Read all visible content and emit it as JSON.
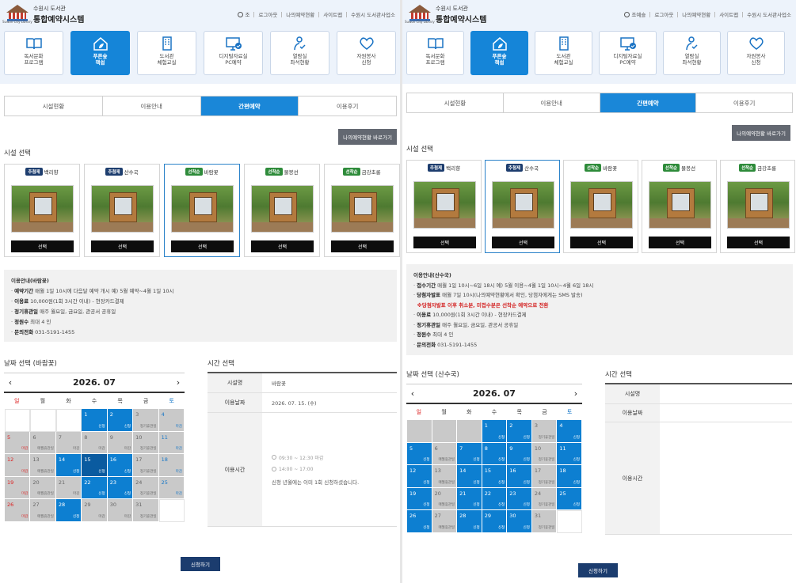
{
  "left": {
    "header": {
      "brand_sup": "수원시 도서관",
      "brand_title": "통합예약시스템",
      "logo_sub": "Suwon City Library",
      "user_label": "조",
      "top_links": [
        "로그아웃",
        "나의예약현황",
        "사이트맵",
        "수원시 도서관사업소"
      ]
    },
    "nav": [
      {
        "label": "독서문화\n프로그램",
        "icon": "book-icon"
      },
      {
        "label": "푸른숲\n책쉼",
        "icon": "house-leaf-icon"
      },
      {
        "label": "도서관\n체험교실",
        "icon": "building-icon"
      },
      {
        "label": "디지털자료실\nPC예약",
        "icon": "monitor-check-icon"
      },
      {
        "label": "열람실\n좌석현황",
        "icon": "person-check-icon"
      },
      {
        "label": "자원봉사\n신청",
        "icon": "heart-hand-icon"
      }
    ],
    "tabs": [
      "시설현황",
      "이용안내",
      "간편예약",
      "이용후기"
    ],
    "my_reservation_button": "나의예약현황 바로가기",
    "facility_title": "시설 선택",
    "facilities": [
      {
        "badge": "추첨제",
        "name": "백리향",
        "button": "선택"
      },
      {
        "badge": "추첨제",
        "name": "산수국",
        "button": "선택"
      },
      {
        "badge": "선착순",
        "name": "바람꽃",
        "button": "선택"
      },
      {
        "badge": "선착순",
        "name": "물봉선",
        "button": "선택"
      },
      {
        "badge": "선착순",
        "name": "금강초롱",
        "button": "선택"
      }
    ],
    "info": {
      "title": "이용안내(바람꽃)",
      "lines": [
        {
          "label": "예약기간",
          "text": "매월 1일 10시에 다음달 예약 개시 예) 5월 예약~4월 1일 10시"
        },
        {
          "label": "이용료",
          "text": "10,000원(1회 3시간 이내) - 현장카드결제"
        },
        {
          "label": "정기휴관일",
          "text": "매주 월요일, 금요일, 관공서 공휴일"
        },
        {
          "label": "정원수",
          "text": "최대 4 인"
        },
        {
          "label": "문의전화",
          "text": "031-5191-1455"
        }
      ]
    },
    "calendar": {
      "title": "날짜 선택 (바람꽃)",
      "prev": "‹",
      "next": "›",
      "month": "2026. 07",
      "dow": [
        "일",
        "월",
        "화",
        "수",
        "목",
        "금",
        "토"
      ]
    },
    "time": {
      "title": "시간 선택",
      "facility_label": "시설명",
      "facility_value": "바람꽃",
      "date_label": "이용날짜",
      "date_value": "2026. 07. 15. (수)",
      "time_label": "이용시간",
      "slots": [
        "09:30 ~ 12:30 마감",
        "14:00 ~ 17:00"
      ],
      "note": "신청 년월에는 이미 1회 신청하셨습니다."
    },
    "apply_button": "신청하기"
  },
  "right": {
    "header": {
      "brand_sup": "수원시 도서관",
      "brand_title": "통합예약시스템",
      "logo_sub": "Suwon City Library",
      "user_label": "조예슬",
      "top_links": [
        "로그아웃",
        "나의예약현황",
        "사이트맵",
        "수원시 도서관사업소"
      ]
    },
    "tabs": [
      "시설현황",
      "이용안내",
      "간편예약",
      "이용후기"
    ],
    "my_reservation_button": "나의예약현황 바로가기",
    "facility_title": "시설 선택",
    "facilities": [
      {
        "badge": "추첨제",
        "name": "백리향",
        "button": "선택"
      },
      {
        "badge": "추첨제",
        "name": "산수국",
        "button": "선택"
      },
      {
        "badge": "선착순",
        "name": "바람꽃",
        "button": "선택"
      },
      {
        "badge": "선착순",
        "name": "물봉선",
        "button": "선택"
      },
      {
        "badge": "선착순",
        "name": "금강초롱",
        "button": "선택"
      }
    ],
    "info": {
      "title": "이용안내(산수국)",
      "lines": [
        {
          "label": "접수기간",
          "text": "매월 1일 10시~6일 18시 예) 5월 이용~4월 1일 10시~4월 6일 18시"
        },
        {
          "label": "당첨자발표",
          "text": "매월 7일 10시(나의예약현황에서 확인, 당첨자에게는 SMS 발송)"
        },
        {
          "warn": "※당첨자발표 이후 취소분, 미접수분은 선착순 예약으로 전환"
        },
        {
          "label": "이용료",
          "text": "10,000원(1회 3시간 이내) - 현장카드결제"
        },
        {
          "label": "정기휴관일",
          "text": "매주 월요일, 금요일, 관공서 공휴일"
        },
        {
          "label": "정원수",
          "text": "최대 4 인"
        },
        {
          "label": "문의전화",
          "text": "031-5191-1455"
        }
      ]
    },
    "calendar": {
      "title": "날짜 선택 (산수국)",
      "prev": "‹",
      "next": "›",
      "month": "2026. 07",
      "dow": [
        "일",
        "월",
        "화",
        "수",
        "목",
        "금",
        "토"
      ]
    },
    "time": {
      "title": "시간 선택",
      "facility_label": "시설명",
      "date_label": "이용날짜",
      "time_label": "이용시간"
    },
    "apply_button": "신청하기"
  },
  "calendars": {
    "left_days": [
      {
        "d": "",
        "s": "",
        "t": "blank"
      },
      {
        "d": "",
        "s": "",
        "t": "blank"
      },
      {
        "d": "",
        "s": "",
        "t": "blank"
      },
      {
        "d": "1",
        "s": "신청",
        "t": "blue"
      },
      {
        "d": "2",
        "s": "신청",
        "t": "blue"
      },
      {
        "d": "3",
        "s": "정기휴관일",
        "t": "gray"
      },
      {
        "d": "4",
        "s": "마감",
        "t": "gray"
      },
      {
        "d": "5",
        "s": "마감",
        "t": "gray"
      },
      {
        "d": "6",
        "s": "매월휴관일",
        "t": "gray"
      },
      {
        "d": "7",
        "s": "마감",
        "t": "gray"
      },
      {
        "d": "8",
        "s": "마감",
        "t": "gray"
      },
      {
        "d": "9",
        "s": "마감",
        "t": "gray"
      },
      {
        "d": "10",
        "s": "정기휴관일",
        "t": "gray"
      },
      {
        "d": "11",
        "s": "마감",
        "t": "gray"
      },
      {
        "d": "12",
        "s": "마감",
        "t": "gray"
      },
      {
        "d": "13",
        "s": "매월휴관일",
        "t": "gray"
      },
      {
        "d": "14",
        "s": "신청",
        "t": "blue"
      },
      {
        "d": "15",
        "s": "신청",
        "t": "dark"
      },
      {
        "d": "16",
        "s": "신청",
        "t": "blue"
      },
      {
        "d": "17",
        "s": "정기휴관일",
        "t": "gray"
      },
      {
        "d": "18",
        "s": "마감",
        "t": "gray"
      },
      {
        "d": "19",
        "s": "마감",
        "t": "gray"
      },
      {
        "d": "20",
        "s": "매월휴관일",
        "t": "gray"
      },
      {
        "d": "21",
        "s": "마감",
        "t": "gray"
      },
      {
        "d": "22",
        "s": "신청",
        "t": "blue"
      },
      {
        "d": "23",
        "s": "신청",
        "t": "blue"
      },
      {
        "d": "24",
        "s": "정기휴관일",
        "t": "gray"
      },
      {
        "d": "25",
        "s": "마감",
        "t": "gray"
      },
      {
        "d": "26",
        "s": "마감",
        "t": "gray"
      },
      {
        "d": "27",
        "s": "매월휴관일",
        "t": "gray"
      },
      {
        "d": "28",
        "s": "신청",
        "t": "blue"
      },
      {
        "d": "29",
        "s": "마감",
        "t": "gray"
      },
      {
        "d": "30",
        "s": "마감",
        "t": "gray"
      },
      {
        "d": "31",
        "s": "정기휴관일",
        "t": "gray"
      },
      {
        "d": "",
        "s": "",
        "t": "blank"
      }
    ],
    "right_days": [
      {
        "d": "",
        "s": "",
        "t": "gray"
      },
      {
        "d": "",
        "s": "",
        "t": "gray"
      },
      {
        "d": "",
        "s": "",
        "t": "gray"
      },
      {
        "d": "1",
        "s": "신청",
        "t": "blue"
      },
      {
        "d": "2",
        "s": "신청",
        "t": "blue"
      },
      {
        "d": "3",
        "s": "정기휴관일",
        "t": "gray"
      },
      {
        "d": "4",
        "s": "신청",
        "t": "blue"
      },
      {
        "d": "5",
        "s": "신청",
        "t": "blue"
      },
      {
        "d": "6",
        "s": "매월휴관일",
        "t": "gray"
      },
      {
        "d": "7",
        "s": "신청",
        "t": "blue"
      },
      {
        "d": "8",
        "s": "신청",
        "t": "blue"
      },
      {
        "d": "9",
        "s": "신청",
        "t": "blue"
      },
      {
        "d": "10",
        "s": "정기휴관일",
        "t": "gray"
      },
      {
        "d": "11",
        "s": "신청",
        "t": "blue"
      },
      {
        "d": "12",
        "s": "신청",
        "t": "blue"
      },
      {
        "d": "13",
        "s": "매월휴관일",
        "t": "gray"
      },
      {
        "d": "14",
        "s": "신청",
        "t": "blue"
      },
      {
        "d": "15",
        "s": "신청",
        "t": "blue"
      },
      {
        "d": "16",
        "s": "신청",
        "t": "blue"
      },
      {
        "d": "17",
        "s": "정기휴관일",
        "t": "gray"
      },
      {
        "d": "18",
        "s": "신청",
        "t": "blue"
      },
      {
        "d": "19",
        "s": "신청",
        "t": "blue"
      },
      {
        "d": "20",
        "s": "매월휴관일",
        "t": "gray"
      },
      {
        "d": "21",
        "s": "신청",
        "t": "blue"
      },
      {
        "d": "22",
        "s": "신청",
        "t": "blue"
      },
      {
        "d": "23",
        "s": "신청",
        "t": "blue"
      },
      {
        "d": "24",
        "s": "정기휴관일",
        "t": "gray"
      },
      {
        "d": "25",
        "s": "신청",
        "t": "blue"
      },
      {
        "d": "26",
        "s": "신청",
        "t": "blue"
      },
      {
        "d": "27",
        "s": "매월휴관일",
        "t": "gray"
      },
      {
        "d": "28",
        "s": "신청",
        "t": "blue"
      },
      {
        "d": "29",
        "s": "신청",
        "t": "blue"
      },
      {
        "d": "30",
        "s": "신청",
        "t": "blue"
      },
      {
        "d": "31",
        "s": "정기휴관일",
        "t": "gray"
      },
      {
        "d": "",
        "s": "",
        "t": "blank"
      }
    ]
  },
  "colors": {
    "accent": "#1585d8",
    "available": "#0d7fd1",
    "selected": "#0a5ba0",
    "closed": "#c9c9c9",
    "apply_button": "#1b3c6e",
    "warning": "#d32222"
  }
}
